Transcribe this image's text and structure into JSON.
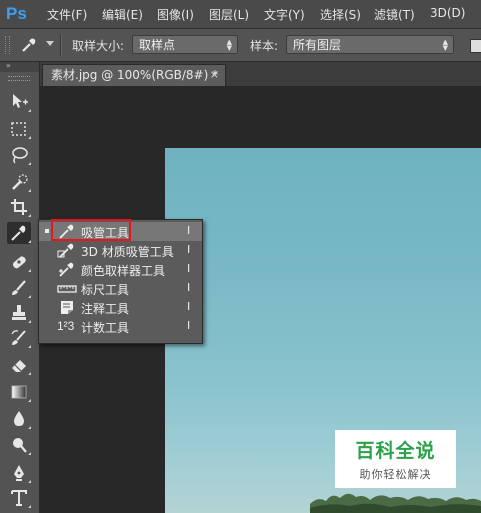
{
  "app": {
    "logo": "Ps"
  },
  "menu": [
    {
      "label": "文件(F)"
    },
    {
      "label": "编辑(E)"
    },
    {
      "label": "图像(I)"
    },
    {
      "label": "图层(L)"
    },
    {
      "label": "文字(Y)"
    },
    {
      "label": "选择(S)"
    },
    {
      "label": "滤镜(T)"
    },
    {
      "label": "3D(D)"
    }
  ],
  "options": {
    "tool_icon": "eyedropper-icon",
    "sample_size_label": "取样大小:",
    "sample_size_value": "取样点",
    "sample_label": "样本:",
    "sample_value": "所有图层"
  },
  "document_tab": {
    "title": "素材.jpg @ 100%(RGB/8#) *",
    "close": "×"
  },
  "toolbar": {
    "collapse": "»",
    "tools": [
      "move-icon",
      "marquee-icon",
      "lasso-icon",
      "quick-select-icon",
      "crop-icon",
      "eyedropper-icon",
      "spot-heal-icon",
      "brush-icon",
      "clone-stamp-icon",
      "history-brush-icon",
      "eraser-icon",
      "gradient-icon",
      "blur-icon",
      "dodge-icon",
      "pen-icon",
      "type-icon"
    ]
  },
  "flyout": {
    "items": [
      {
        "label": "吸管工具",
        "shortcut": "I",
        "icon": "eyedropper-icon",
        "selected": true
      },
      {
        "label": "3D 材质吸管工具",
        "shortcut": "I",
        "icon": "3d-material-eyedropper-icon",
        "selected": false
      },
      {
        "label": "颜色取样器工具",
        "shortcut": "I",
        "icon": "color-sampler-icon",
        "selected": false
      },
      {
        "label": "标尺工具",
        "shortcut": "I",
        "icon": "ruler-icon",
        "selected": false
      },
      {
        "label": "注释工具",
        "shortcut": "I",
        "icon": "note-icon",
        "selected": false
      },
      {
        "label": "计数工具",
        "shortcut": "I",
        "icon": "count-icon",
        "selected": false
      }
    ],
    "count_glyph": "1²3"
  },
  "watermark": {
    "title": "百科全说",
    "subtitle": "助你轻松解决"
  },
  "colors": {
    "highlight_box": "#e0191d",
    "ps_blue": "#3ea0ee",
    "watermark_green": "#2aa24a"
  }
}
